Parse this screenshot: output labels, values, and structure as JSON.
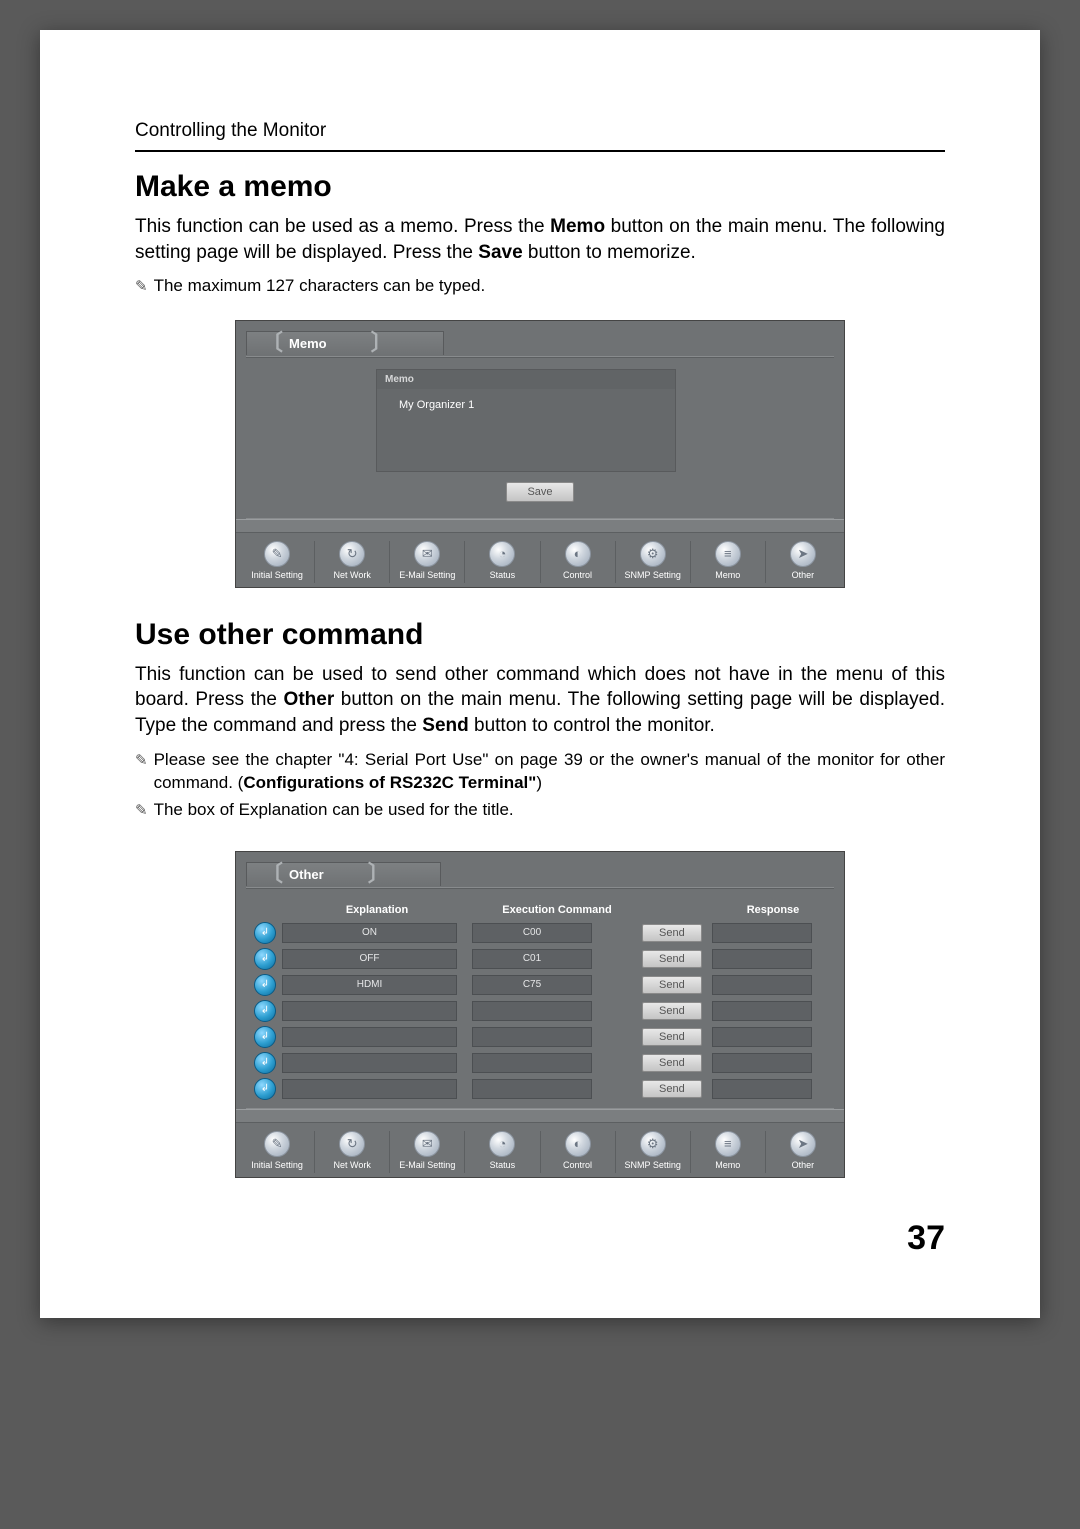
{
  "header": "Controlling the Monitor",
  "section1": {
    "heading": "Make a memo",
    "body_parts": [
      "This function can be used as a memo. Press the ",
      "Memo",
      " button on the main menu. The following setting page will be displayed.  Press the ",
      "Save",
      " button to memorize."
    ],
    "note": "The maximum 127 characters can be typed."
  },
  "memo_screenshot": {
    "tab": "Memo",
    "panel_head": "Memo",
    "panel_text": "My Organizer 1",
    "save": "Save"
  },
  "nav": [
    {
      "label": "Initial Setting",
      "glyph": "✎"
    },
    {
      "label": "Net Work",
      "glyph": "↻"
    },
    {
      "label": "E-Mail Setting",
      "glyph": "✉"
    },
    {
      "label": "Status",
      "glyph": "◔"
    },
    {
      "label": "Control",
      "glyph": "◐"
    },
    {
      "label": "SNMP Setting",
      "glyph": "⚙"
    },
    {
      "label": "Memo",
      "glyph": "≡"
    },
    {
      "label": "Other",
      "glyph": "➤"
    }
  ],
  "section2": {
    "heading": "Use other command",
    "body_parts": [
      "This function can be used to send other command which does not have in the menu of this board. Press the ",
      "Other",
      " button on the main menu. The following setting page will be displayed.  Type the command and press the ",
      "Send",
      " button to control the monitor."
    ],
    "note1_a": "Please see the chapter \"4: Serial Port Use\" on page 39 or the owner's manual of the monitor for other command. (",
    "note1_b": "Configurations of RS232C Terminal\"",
    "note1_c": ")",
    "note2": "The box of Explanation can be used for the title."
  },
  "other_screenshot": {
    "tab": "Other",
    "headers": {
      "expl": "Explanation",
      "cmd": "Execution Command",
      "resp": "Response"
    },
    "rows": [
      {
        "expl": "ON",
        "cmd": "C00"
      },
      {
        "expl": "OFF",
        "cmd": "C01"
      },
      {
        "expl": "HDMI",
        "cmd": "C75"
      },
      {
        "expl": "",
        "cmd": ""
      },
      {
        "expl": "",
        "cmd": ""
      },
      {
        "expl": "",
        "cmd": ""
      },
      {
        "expl": "",
        "cmd": ""
      }
    ],
    "send": "Send"
  },
  "page_number": "37"
}
